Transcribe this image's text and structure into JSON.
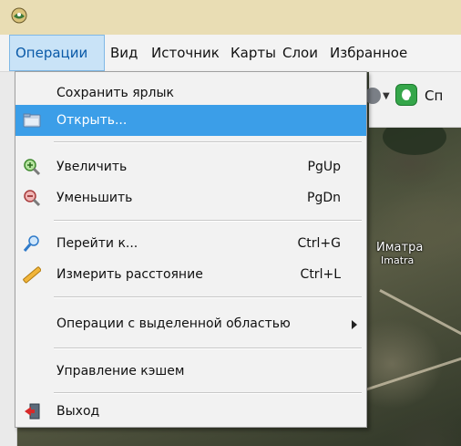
{
  "menubar": {
    "items": [
      {
        "label": "Операции",
        "active": true
      },
      {
        "label": "Вид"
      },
      {
        "label": "Источник"
      },
      {
        "label": "Карты"
      },
      {
        "label": "Слои"
      },
      {
        "label": "Избранное"
      }
    ]
  },
  "toolbar": {
    "partial_text": "Сп",
    "icons": [
      "globe-icon",
      "dropdown-caret-icon",
      "green-leaf-icon"
    ]
  },
  "map": {
    "label_ru": "Иматра",
    "label_en": "Imatra"
  },
  "dropdown": {
    "items": [
      {
        "label": "Сохранить ярлык",
        "shortcut": "",
        "icon": null
      },
      {
        "label": "Открыть...",
        "shortcut": "",
        "icon": "folder-icon",
        "highlighted": true
      },
      {
        "label": "Увеличить",
        "shortcut": "PgUp",
        "icon": "zoom-in-icon"
      },
      {
        "label": "Уменьшить",
        "shortcut": "PgDn",
        "icon": "zoom-out-icon"
      },
      {
        "label": "Перейти к...",
        "shortcut": "Ctrl+G",
        "icon": "goto-icon"
      },
      {
        "label": "Измерить расстояние",
        "shortcut": "Ctrl+L",
        "icon": "ruler-icon"
      },
      {
        "label": "Операции с выделенной областью",
        "shortcut": "",
        "icon": null,
        "submenu": true
      },
      {
        "label": "Управление кэшем",
        "shortcut": "",
        "icon": null
      },
      {
        "label": "Выход",
        "shortcut": "",
        "icon": "exit-icon"
      }
    ]
  },
  "colors": {
    "highlight": "#3b9ee8",
    "menu_active_bg": "#c9e3f7",
    "menu_active_text": "#0a5aa8"
  }
}
